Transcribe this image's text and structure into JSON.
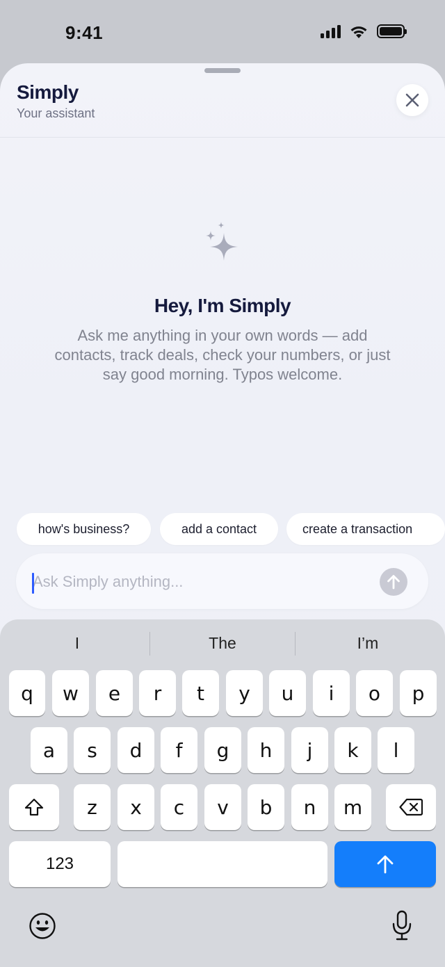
{
  "status_bar": {
    "time": "9:41"
  },
  "header": {
    "title": "Simply",
    "subtitle": "Your assistant",
    "close_icon": "close-icon"
  },
  "hero": {
    "icon": "sparkles-icon",
    "title": "Hey, I'm Simply",
    "body": "Ask me anything in your own words — add contacts, track deals, check your numbers, or just say good morning. Typos welcome."
  },
  "suggestions": [
    {
      "label": "how's business?"
    },
    {
      "label": "add a contact"
    },
    {
      "label": "create a transaction"
    }
  ],
  "composer": {
    "placeholder": "Ask Simply anything...",
    "value": "",
    "send_icon": "arrow-up-icon"
  },
  "keyboard": {
    "predictions": [
      "I",
      "The",
      "I’m"
    ],
    "row1": [
      "q",
      "w",
      "e",
      "r",
      "t",
      "y",
      "u",
      "i",
      "o",
      "p"
    ],
    "row2": [
      "a",
      "s",
      "d",
      "f",
      "g",
      "h",
      "j",
      "k",
      "l"
    ],
    "row3": [
      "z",
      "x",
      "c",
      "v",
      "b",
      "n",
      "m"
    ],
    "numbers_label": "123",
    "shift_icon": "shift-icon",
    "delete_icon": "backspace-icon",
    "return_icon": "arrow-up-icon",
    "emoji_icon": "emoji-icon",
    "mic_icon": "microphone-icon",
    "accent_color": "#147efb"
  }
}
